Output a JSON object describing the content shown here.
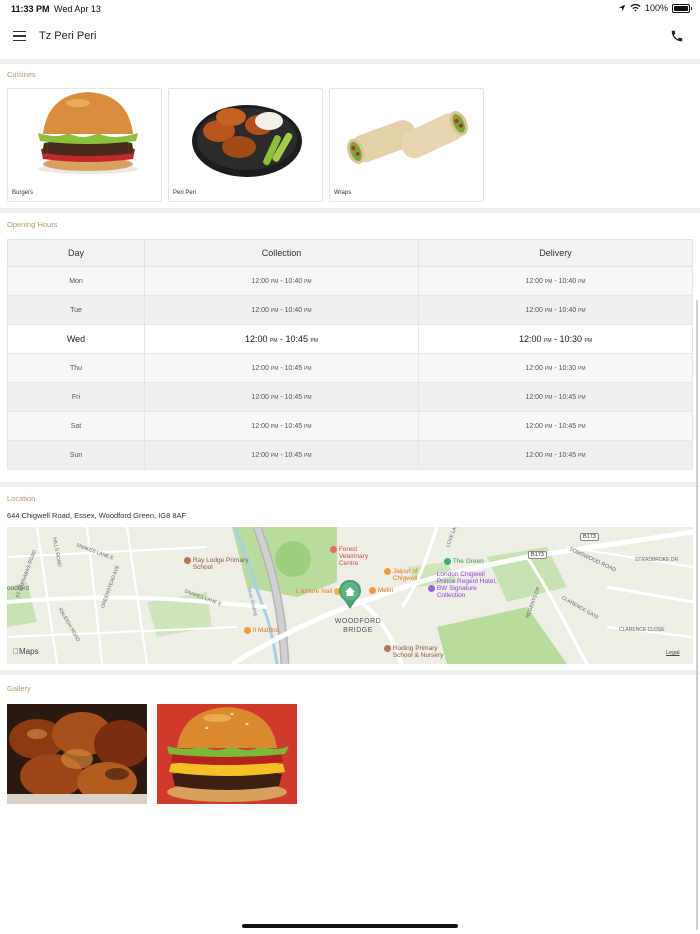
{
  "status_bar": {
    "time": "11:33 PM",
    "date": "Wed Apr 13",
    "battery": "100%"
  },
  "header": {
    "title": "Tz Peri Peri",
    "menu_icon": "hamburger-menu-icon",
    "call_icon": "phone-icon"
  },
  "cuisines": {
    "title": "Cuisines",
    "items": [
      {
        "label": "Burgers"
      },
      {
        "label": "Peri Peri"
      },
      {
        "label": "Wraps"
      }
    ]
  },
  "opening_hours": {
    "title": "Opening Hours",
    "headers": {
      "day": "Day",
      "collection": "Collection",
      "delivery": "Delivery"
    },
    "rows": [
      {
        "day": "Mon",
        "collection": "12:00 PM - 10:40 PM",
        "delivery": "12:00 PM - 10:40 PM"
      },
      {
        "day": "Tue",
        "collection": "12:00 PM - 10:40 PM",
        "delivery": "12:00 PM - 10:40 PM"
      },
      {
        "day": "Wed",
        "collection": "12:00 PM - 10:45 PM",
        "delivery": "12:00 PM - 10:30 PM"
      },
      {
        "day": "Thu",
        "collection": "12:00 PM - 10:45 PM",
        "delivery": "12:00 PM - 10:30 PM"
      },
      {
        "day": "Fri",
        "collection": "12:00 PM - 10:45 PM",
        "delivery": "12:00 PM - 10:45 PM"
      },
      {
        "day": "Sat",
        "collection": "12:00 PM - 10:45 PM",
        "delivery": "12:00 PM - 10:45 PM"
      },
      {
        "day": "Sun",
        "collection": "12:00 PM - 10:45 PM",
        "delivery": "12:00 PM - 10:45 PM"
      }
    ]
  },
  "location": {
    "title": "Location",
    "address": "644 Chigwell Road, Essex, Woodford Green, IG8 8AF",
    "map": {
      "labels": {
        "ray_lodge": "Ray Lodge Primary School",
        "forest_vet": "Forest Veterinary Centre",
        "jaipur": "Jaipur of Chigwell",
        "the_green": "The Green",
        "london_chigwell": "London Chigwell Prince Regent Hotel, BW Signature Collection",
        "lamore": "L'amore Nail",
        "melin": "Melin",
        "woodford_bridge": "WOODFORD BRIDGE",
        "il_mattino": "Il Mattino",
        "roding": "Roding Primary School & Nursery",
        "b173a": "B173",
        "b173b": "B173",
        "tomswood": "TOMSWOOD ROAD",
        "stradbroke": "STRADBROKE DR",
        "clarence_gate": "CLARENCE GATE",
        "clarence_close": "CLARENCE CLOSE",
        "snakes_lane_e": "SNAKES LANE E",
        "snakes_lane_e2": "SNAKES LANE E",
        "st_barnabas": "ST BARNABAS ROAD",
        "raleigh": "RALEIGH ROAD",
        "greenstead": "GREENSTEAD AVE",
        "hills_road": "HILLS ROAD",
        "woodford_left": "oodford",
        "love_lane": "LOVE LANE",
        "river_roding": "River Roding",
        "regents": "REGENTS DR",
        "maps_brand": "Maps",
        "legal": "Legal"
      }
    }
  },
  "gallery": {
    "title": "Gallery"
  }
}
